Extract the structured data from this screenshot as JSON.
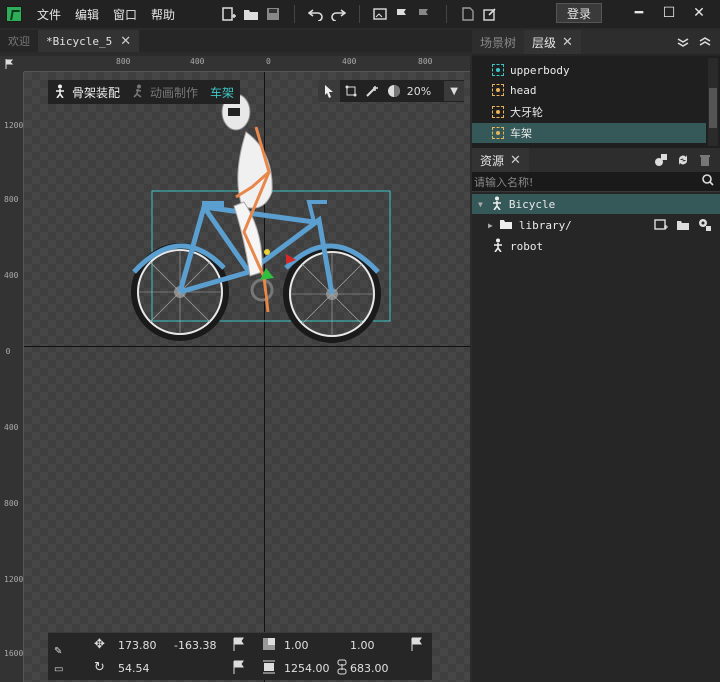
{
  "menu": [
    "文件",
    "编辑",
    "窗口",
    "帮助"
  ],
  "login_label": "登录",
  "tabs": [
    {
      "label": "欢迎"
    },
    {
      "label": "*Bicycle_5"
    }
  ],
  "ruler": {
    "top": [
      "800",
      "400",
      "0",
      "400",
      "800"
    ],
    "left": [
      "1200",
      "800",
      "400",
      "0",
      "400",
      "800",
      "1200",
      "1600"
    ]
  },
  "modes": {
    "rigging": "骨架装配",
    "animation": "动画制作",
    "selected": "车架"
  },
  "zoom": "20%",
  "properties": {
    "pos_x": "173.80",
    "pos_y": "-163.38",
    "scale_x": "1.00",
    "scale_y": "1.00",
    "rotation": "54.54",
    "size_w": "1254.00",
    "size_h": "683.00"
  },
  "right_tabs": {
    "scene_tree": "场景树",
    "layers": "层级",
    "assets": "资源"
  },
  "layers": [
    {
      "name": "upperbody"
    },
    {
      "name": "head"
    },
    {
      "name": "大牙轮"
    },
    {
      "name": "车架"
    }
  ],
  "assets": {
    "search_placeholder": "请输入名称!",
    "items": [
      {
        "name": "Bicycle"
      },
      {
        "name": "library/"
      },
      {
        "name": "robot"
      }
    ]
  },
  "colors": {
    "accent": "#3ec6c6",
    "selection": "#355859",
    "bike": "#5a9fd0"
  }
}
